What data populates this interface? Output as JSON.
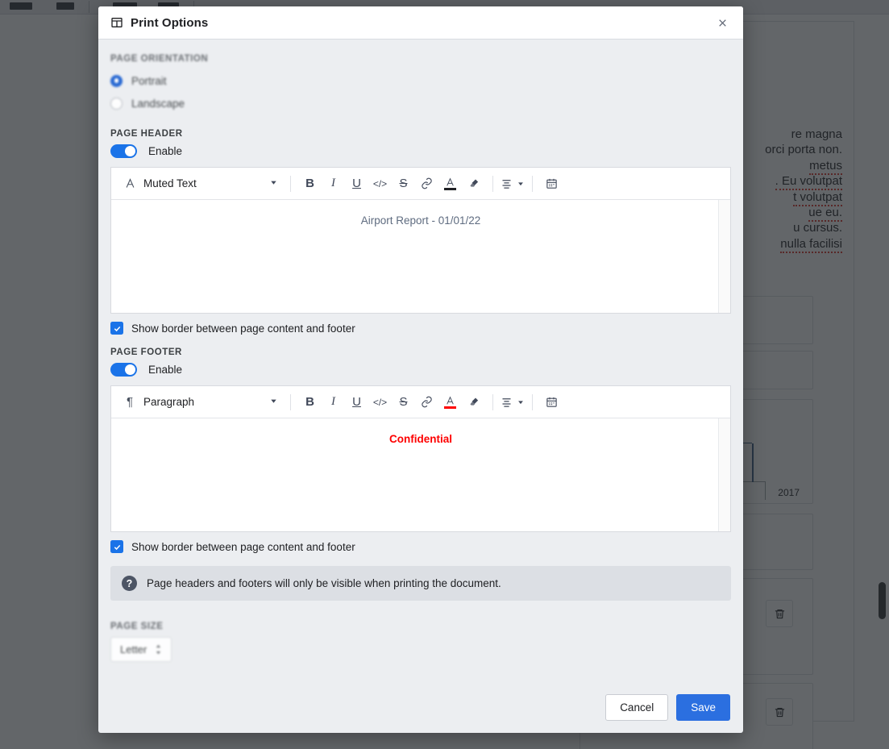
{
  "modal": {
    "title": "Print Options",
    "close_icon": "close-icon",
    "window_icon": "layout-icon"
  },
  "orientation": {
    "label": "PAGE ORIENTATION",
    "options": [
      {
        "label": "Portrait",
        "selected": true
      },
      {
        "label": "Landscape",
        "selected": false
      }
    ]
  },
  "page_header": {
    "label": "PAGE HEADER",
    "toggle_label": "Enable",
    "toggle_on": true,
    "style_name": "Muted Text",
    "style_icon": "font-letter-icon",
    "content": "Airport Report - 01/01/22",
    "text_color": "#5f6c80",
    "color_bar": "#202124",
    "checkbox_label": "Show border between page content and footer",
    "checkbox_checked": true
  },
  "page_footer": {
    "label": "PAGE FOOTER",
    "toggle_label": "Enable",
    "toggle_on": true,
    "style_name": "Paragraph",
    "style_icon": "pilcrow-icon",
    "content": "Confidential",
    "text_color": "#fe0000",
    "color_bar": "#fe0000",
    "checkbox_label": "Show border between page content and footer",
    "checkbox_checked": true
  },
  "toolbar_buttons": [
    {
      "name": "bold-button",
      "glyph": "B"
    },
    {
      "name": "italic-button",
      "glyph": "I"
    },
    {
      "name": "underline-button",
      "glyph": "U"
    },
    {
      "name": "code-button",
      "glyph": "</>"
    },
    {
      "name": "strikethrough-button",
      "glyph": "S"
    },
    {
      "name": "link-button",
      "glyph": "link"
    },
    {
      "name": "text-color-button",
      "glyph": "A"
    },
    {
      "name": "clear-format-button",
      "glyph": "eraser"
    },
    {
      "name": "align-button",
      "glyph": "align"
    },
    {
      "name": "date-button",
      "glyph": "calendar"
    }
  ],
  "info": {
    "icon": "help-icon",
    "text": "Page headers and footers will only be visible when printing the document."
  },
  "page_size": {
    "label": "PAGE SIZE",
    "value": "Letter"
  },
  "footer_actions": {
    "cancel": "Cancel",
    "save": "Save"
  },
  "background": {
    "document_lines": [
      "re magna",
      "orci porta non.",
      "metus",
      ". Eu volutpat",
      "t volutpat",
      "ue eu.",
      "u cursus.",
      "nulla facilisi"
    ],
    "chart_axis_label": "2017",
    "trash_icon": "trash-icon"
  },
  "colors": {
    "accent": "#1a73e8",
    "save_button": "#2b6fe0",
    "danger": "#fe0000",
    "overlay": "rgba(33,37,41,0.70)"
  }
}
